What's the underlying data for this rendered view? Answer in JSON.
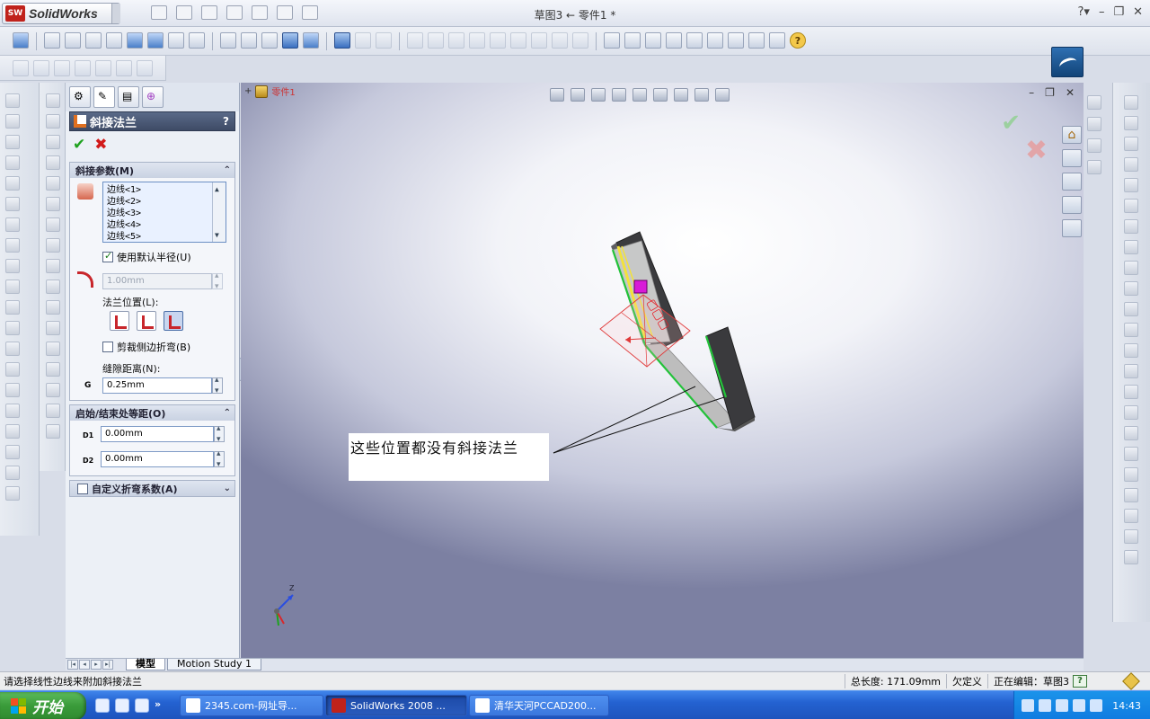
{
  "app": {
    "name": "SolidWorks",
    "badge": "SW"
  },
  "window": {
    "title": "草图3 ← 零件1 *"
  },
  "colors": {
    "accent": "#c0221b",
    "header": "#3e4b66",
    "ok": "#1fa21f",
    "cancel": "#d21a1a"
  },
  "property_manager": {
    "title": "斜接法兰",
    "help": "?",
    "miter_group": {
      "title": "斜接参数(M)",
      "edges": [
        "边线<1>",
        "边线<2>",
        "边线<3>",
        "边线<4>",
        "边线<5>"
      ],
      "use_default_radius": "使用默认半径(U)",
      "radius_value": "1.00mm",
      "flange_position": "法兰位置(L):",
      "trim_side_bends": "剪裁侧边折弯(B)",
      "gap_distance": "缝隙距离(N):",
      "gap_value": "0.25mm"
    },
    "offset_group": {
      "title": "启始/结束处等距(O)",
      "d1_value": "0.00mm",
      "d2_value": "0.00mm",
      "d1_label": "D1",
      "d2_label": "D2"
    },
    "custom_bend": "自定义折弯系数(A)"
  },
  "graphics": {
    "part_name": "零件1",
    "annotation": "这些位置都没有斜接法兰",
    "axis_label": "Z"
  },
  "bottom_tabs": {
    "model": "模型",
    "motion": "Motion Study 1"
  },
  "statusbar": {
    "message": "请选择线性边线来附加斜接法兰",
    "total_length": "总长度: 171.09mm",
    "definition": "欠定义",
    "editing": "正在编辑：草图3",
    "help": "?"
  },
  "taskbar": {
    "start": "开始",
    "more": "»",
    "tasks": [
      "2345.com-网址导...",
      "SolidWorks 2008 ...",
      "清华天河PCCAD200..."
    ],
    "clock": "14:43"
  }
}
